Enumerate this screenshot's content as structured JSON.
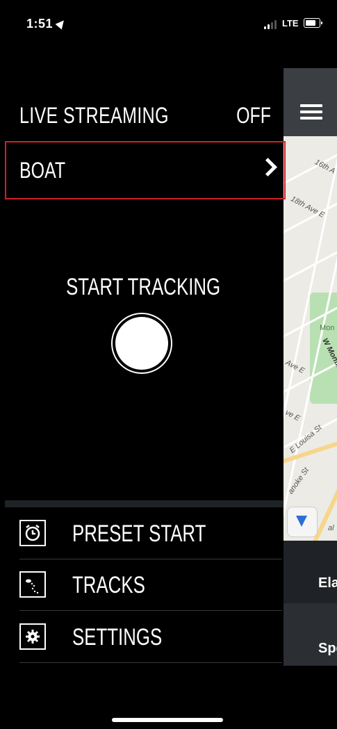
{
  "status_bar": {
    "time": "1:51",
    "network": "LTE"
  },
  "drawer": {
    "live_streaming": {
      "label": "LIVE STREAMING",
      "value": "OFF"
    },
    "boat": {
      "label": "BOAT"
    },
    "start_tracking": {
      "label": "START TRACKING"
    },
    "menu": [
      {
        "label": "PRESET START",
        "icon": "alarm-clock-icon"
      },
      {
        "label": "TRACKS",
        "icon": "track-path-icon"
      },
      {
        "label": "SETTINGS",
        "icon": "gear-icon"
      }
    ]
  },
  "map_panel": {
    "labels": [
      "16th A",
      "18th Ave E",
      "Mon",
      "W Montlak",
      "Ave E",
      "ve E",
      "E Louisa St",
      "anoke St",
      "al"
    ],
    "data_rows": [
      "Ela",
      "Spe"
    ]
  },
  "colors": {
    "highlight": "#d3202a",
    "park": "#b9e0b2",
    "major_road": "#f7d58a"
  }
}
